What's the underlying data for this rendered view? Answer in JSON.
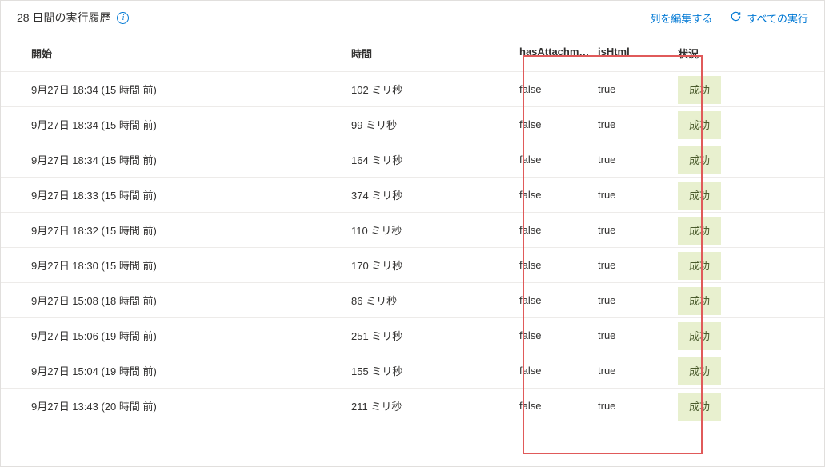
{
  "header": {
    "title": "28 日間の実行履歴",
    "edit_columns": "列を編集する",
    "all_runs": "すべての実行"
  },
  "columns": {
    "start": "開始",
    "duration": "時間",
    "hasAttachment": "hasAttachme...",
    "isHtml": "isHtml",
    "status": "状況"
  },
  "rows": [
    {
      "start": "9月27日 18:34 (15 時間 前)",
      "duration": "102 ミリ秒",
      "hasAttachment": "false",
      "isHtml": "true",
      "status": "成功"
    },
    {
      "start": "9月27日 18:34 (15 時間 前)",
      "duration": "99 ミリ秒",
      "hasAttachment": "false",
      "isHtml": "true",
      "status": "成功"
    },
    {
      "start": "9月27日 18:34 (15 時間 前)",
      "duration": "164 ミリ秒",
      "hasAttachment": "false",
      "isHtml": "true",
      "status": "成功"
    },
    {
      "start": "9月27日 18:33 (15 時間 前)",
      "duration": "374 ミリ秒",
      "hasAttachment": "false",
      "isHtml": "true",
      "status": "成功"
    },
    {
      "start": "9月27日 18:32 (15 時間 前)",
      "duration": "110 ミリ秒",
      "hasAttachment": "false",
      "isHtml": "true",
      "status": "成功"
    },
    {
      "start": "9月27日 18:30 (15 時間 前)",
      "duration": "170 ミリ秒",
      "hasAttachment": "false",
      "isHtml": "true",
      "status": "成功"
    },
    {
      "start": "9月27日 15:08 (18 時間 前)",
      "duration": "86 ミリ秒",
      "hasAttachment": "false",
      "isHtml": "true",
      "status": "成功"
    },
    {
      "start": "9月27日 15:06 (19 時間 前)",
      "duration": "251 ミリ秒",
      "hasAttachment": "false",
      "isHtml": "true",
      "status": "成功"
    },
    {
      "start": "9月27日 15:04 (19 時間 前)",
      "duration": "155 ミリ秒",
      "hasAttachment": "false",
      "isHtml": "true",
      "status": "成功"
    },
    {
      "start": "9月27日 13:43 (20 時間 前)",
      "duration": "211 ミリ秒",
      "hasAttachment": "false",
      "isHtml": "true",
      "status": "成功"
    }
  ]
}
